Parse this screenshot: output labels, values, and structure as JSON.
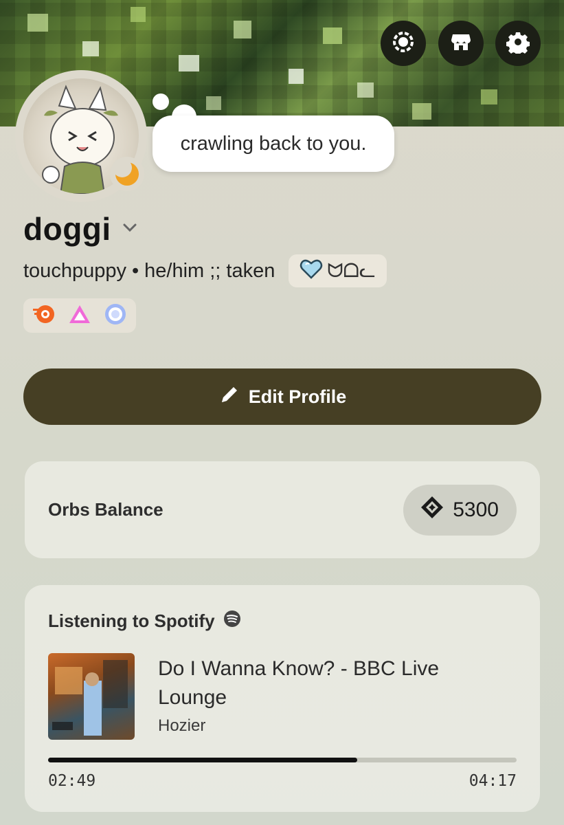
{
  "banner": {
    "buttons": [
      {
        "icon": "nitro-badge-icon"
      },
      {
        "icon": "shop-icon"
      },
      {
        "icon": "gear-icon"
      }
    ]
  },
  "profile": {
    "custom_status": "crawling back to you.",
    "status": "idle",
    "display_name": "doggi",
    "username": "touchpuppy",
    "separator": "•",
    "pronouns": "he/him ;; taken",
    "tag_text": "ᗢᗝᓚ",
    "tag_icon": "heart-icon",
    "badges": [
      "hypesquad-badge-icon",
      "nitro-triangle-badge-icon",
      "boost-badge-icon"
    ]
  },
  "actions": {
    "edit_profile_label": "Edit Profile"
  },
  "orbs": {
    "label": "Orbs Balance",
    "value": "5300"
  },
  "spotify": {
    "header": "Listening to Spotify",
    "track_title": "Do I Wanna Know? - BBC Live Lounge",
    "artist": "Hozier",
    "elapsed": "02:49",
    "duration": "04:17",
    "progress": 0.66
  },
  "colors": {
    "accent_button": "#463f24",
    "status_idle": "#f0a224"
  }
}
